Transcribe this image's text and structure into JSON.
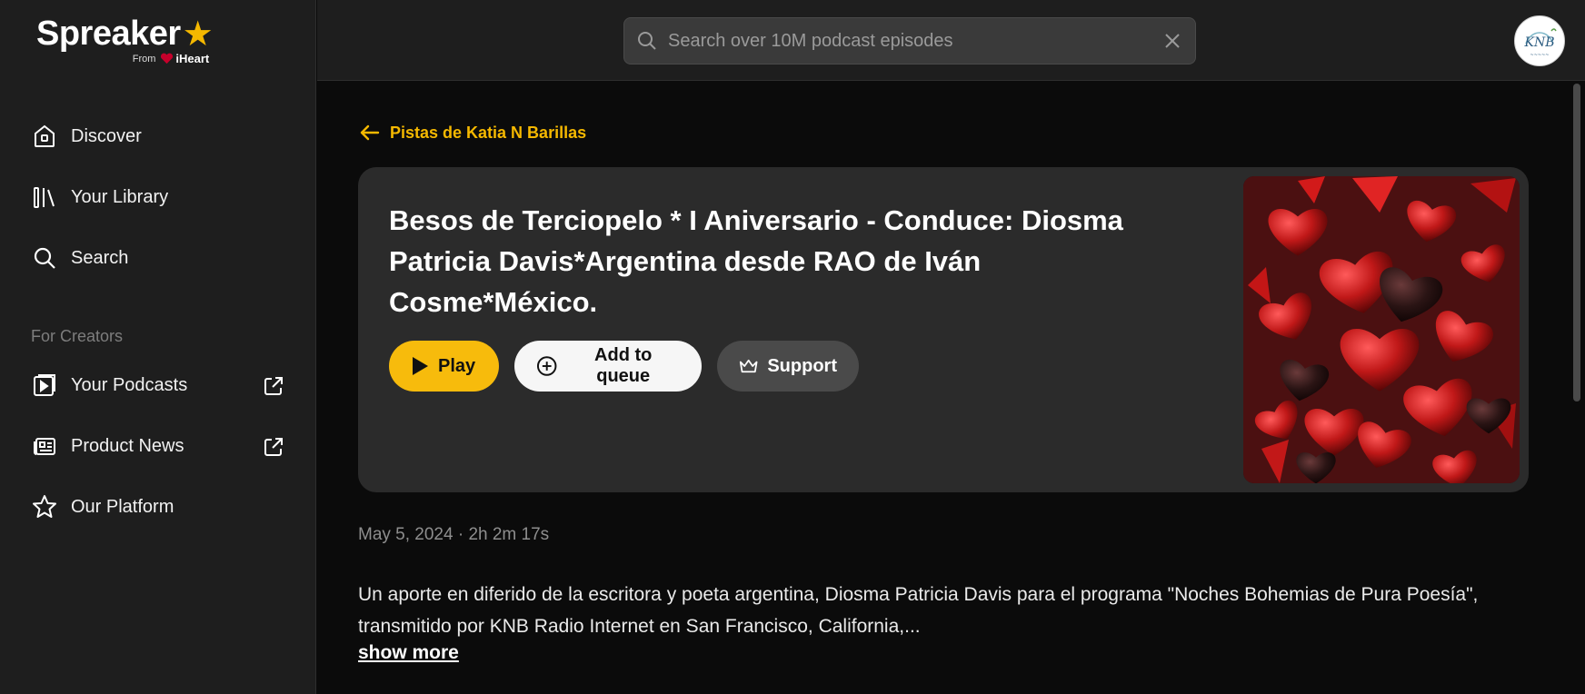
{
  "brand": {
    "name": "Spreaker",
    "from_label": "From",
    "partner": "iHeart",
    "accent_color": "#f5b800"
  },
  "sidebar": {
    "items": [
      {
        "label": "Discover",
        "icon": "home-icon"
      },
      {
        "label": "Your Library",
        "icon": "library-icon"
      },
      {
        "label": "Search",
        "icon": "search-icon"
      }
    ],
    "creators_title": "For Creators",
    "creator_items": [
      {
        "label": "Your Podcasts",
        "icon": "podcast-icon",
        "external": true
      },
      {
        "label": "Product News",
        "icon": "news-icon",
        "external": true
      },
      {
        "label": "Our Platform",
        "icon": "star-icon",
        "external": false
      }
    ]
  },
  "topbar": {
    "search_placeholder": "Search over 10M podcast episodes",
    "search_value": ""
  },
  "episode": {
    "back_label": "Pistas de Katia N Barillas",
    "title": "Besos de Terciopelo * I Aniversario - Conduce: Diosma Patricia Davis*Argentina desde RAO de Iván Cosme*México.",
    "play_label": "Play",
    "queue_label": "Add to queue",
    "support_label": "Support",
    "meta": "May 5, 2024 · 2h 2m 17s",
    "description": "Un aporte en diferido de la escritora y poeta argentina, Diosma Patricia Davis para el programa \"Noches Bohemias de Pura Poesía\", transmitido por KNB Radio Internet en San Francisco, California,...",
    "show_more_label": "show more"
  }
}
